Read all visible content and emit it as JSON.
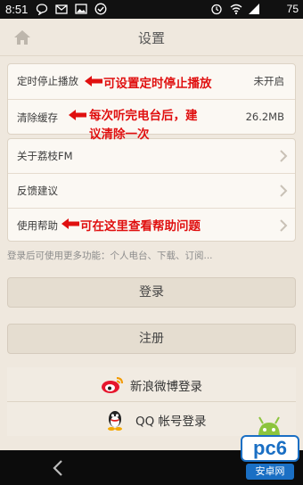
{
  "status_bar": {
    "time": "8:51",
    "battery": "75"
  },
  "header": {
    "title": "设置"
  },
  "settings": {
    "timer_label": "定时停止播放",
    "timer_value": "未开启",
    "clear_cache_label": "清除缓存",
    "cache_size": "26.2MB",
    "about_label": "关于荔枝FM",
    "feedback_label": "反馈建议",
    "help_label": "使用帮助"
  },
  "annotations": {
    "timer_note": "可设置定时停止播放",
    "cache_note_line1": "每次听完电台后，建",
    "cache_note_line2": "议清除一次",
    "help_note": "可在这里查看帮助问题"
  },
  "hint": "登录后可使用更多功能：个人电台、下载、订阅...",
  "buttons": {
    "login": "登录",
    "register": "注册",
    "weibo_login": "新浪微博登录",
    "qq_login": "QQ 帐号登录"
  },
  "watermark": {
    "brand": "pc6",
    "site": "安卓网"
  },
  "colors": {
    "background": "#efe8de",
    "card": "#fbf8f3",
    "annotation": "#e01010",
    "weibo": "#e6162d",
    "watermark_blue": "#1a6fc4"
  }
}
